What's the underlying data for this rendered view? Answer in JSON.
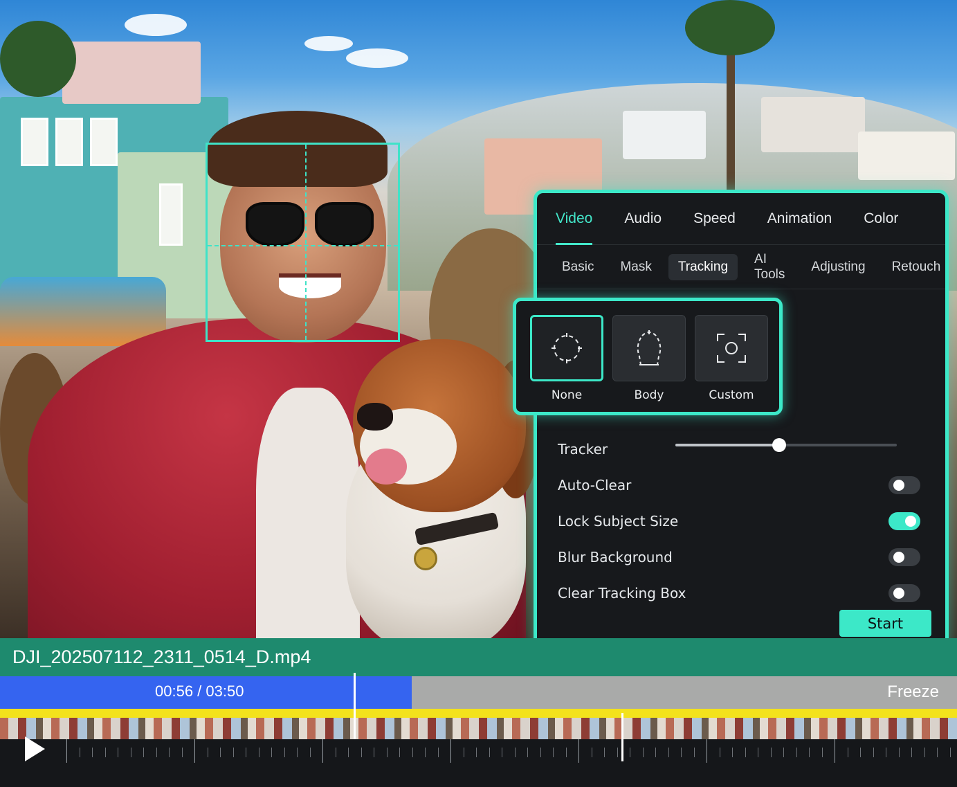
{
  "panel": {
    "tabs": [
      {
        "label": "Video",
        "active": true
      },
      {
        "label": "Audio",
        "active": false
      },
      {
        "label": "Speed",
        "active": false
      },
      {
        "label": "Animation",
        "active": false
      },
      {
        "label": "Color",
        "active": false
      }
    ],
    "subtabs": [
      {
        "label": "Basic",
        "active": false
      },
      {
        "label": "Mask",
        "active": false
      },
      {
        "label": "Tracking",
        "active": true
      },
      {
        "label": "AI Tools",
        "active": false
      },
      {
        "label": "Adjusting",
        "active": false
      },
      {
        "label": "Retouch",
        "active": false
      }
    ],
    "modes": [
      {
        "label": "None",
        "icon": "circle-target-icon",
        "selected": true
      },
      {
        "label": "Body",
        "icon": "body-outline-icon",
        "selected": false
      },
      {
        "label": "Custom",
        "icon": "corner-frame-icon",
        "selected": false
      }
    ],
    "tracker": {
      "label": "Tracker",
      "value": 0.47
    },
    "toggles": [
      {
        "label": "Auto-Clear",
        "on": false
      },
      {
        "label": "Lock Subject Size",
        "on": true
      },
      {
        "label": "Blur Background",
        "on": false
      },
      {
        "label": "Clear Tracking Box",
        "on": false
      }
    ],
    "start_label": "Start"
  },
  "timeline": {
    "filename": "DJI_202507112_2311_0514_D.mp4",
    "timecode": "00:56 / 03:50",
    "freeze_label": "Freeze",
    "played_fraction": 0.43
  },
  "colors": {
    "accent": "#3ce8c8",
    "filebar": "#1e8a6e",
    "played": "#3564f0",
    "marker": "#f3e21c"
  }
}
